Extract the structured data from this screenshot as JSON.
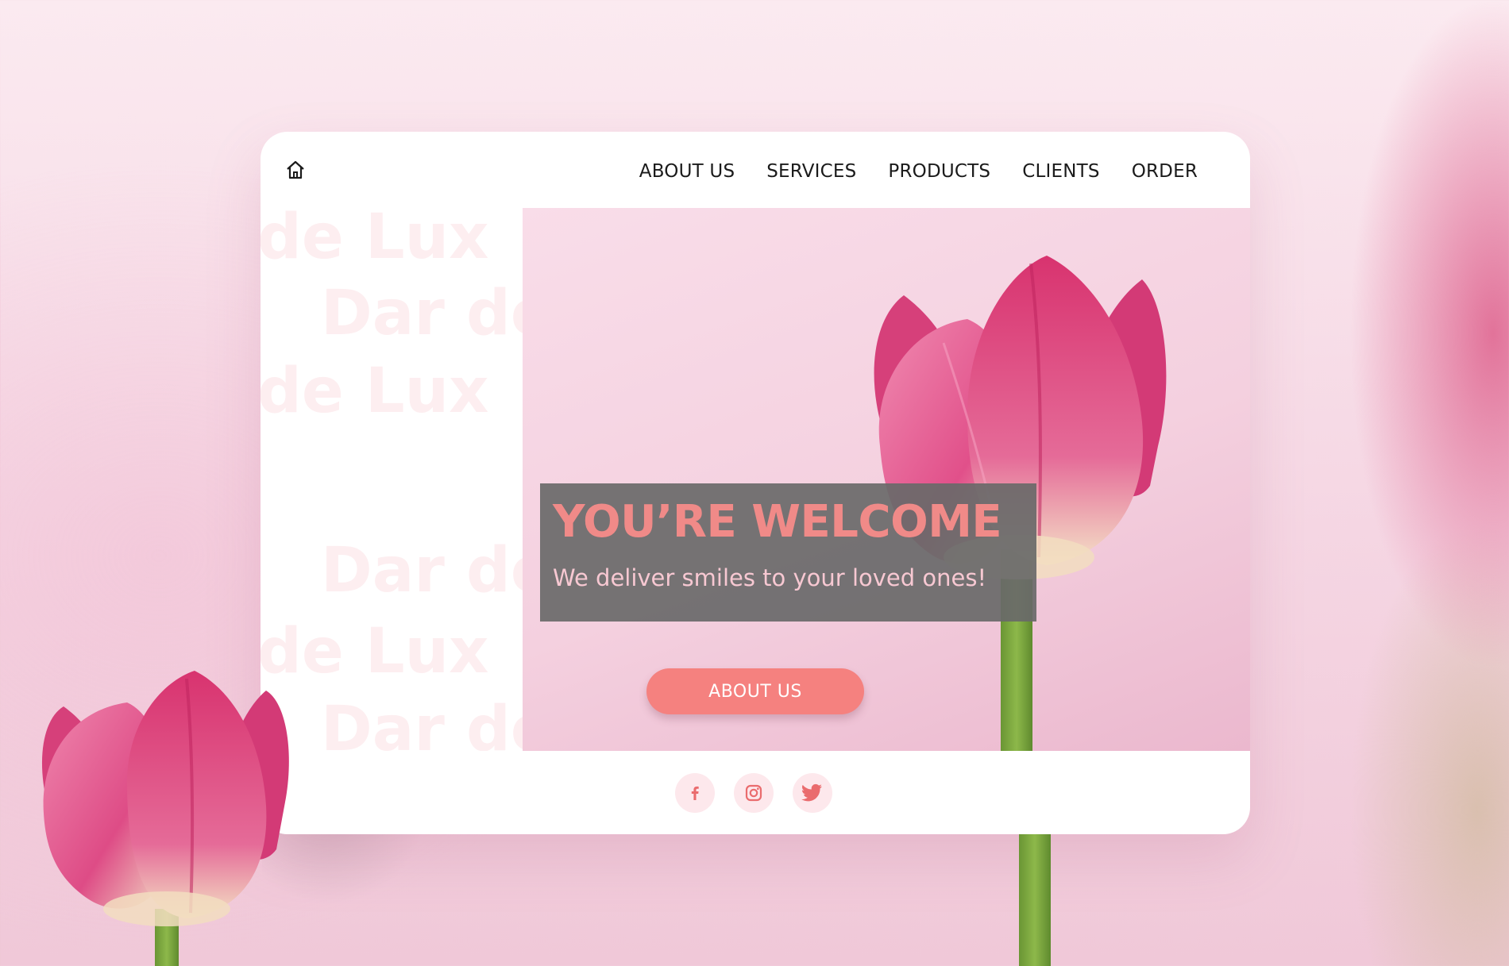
{
  "nav": {
    "home_icon": "home-icon",
    "links": [
      "ABOUT US",
      "SERVICES",
      "PRODUCTS",
      "CLIENTS",
      "ORDER"
    ]
  },
  "watermark": {
    "line_a": "de Lux",
    "line_b": "Dar de"
  },
  "hero": {
    "title": "YOU’RE WELCOME",
    "subtitle": "We deliver smiles to your loved ones!",
    "button_label": "ABOUT US"
  },
  "footer": {
    "socials": [
      "facebook-icon",
      "instagram-icon",
      "twitter-icon"
    ]
  },
  "colors": {
    "accent": "#f5817f",
    "title": "#f08a88",
    "banner_bg": "#696969",
    "social_bg": "#fde8ec",
    "tulip": "#e0457c",
    "stem": "#7ba23f"
  }
}
